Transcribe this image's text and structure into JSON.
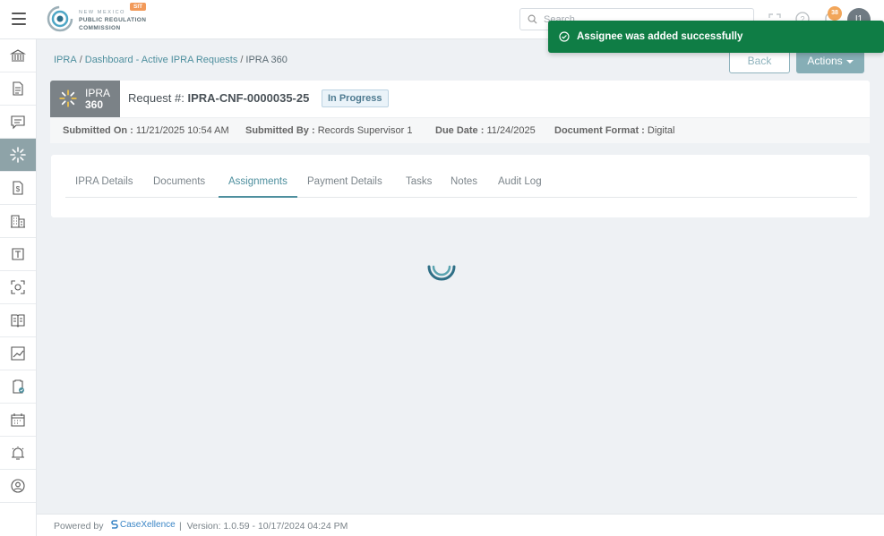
{
  "header": {
    "logo": {
      "line1": "NEW MEXICO",
      "line2": "PUBLIC REGULATION",
      "line3": "COMMISSION",
      "env_badge": "SIT"
    },
    "search": {
      "placeholder": "Search",
      "value": ""
    },
    "notification_count": "38",
    "avatar_initials": "I1"
  },
  "sidebar": {
    "items": [
      {
        "icon": "bank-icon"
      },
      {
        "icon": "document-icon"
      },
      {
        "icon": "chat-icon"
      },
      {
        "icon": "ipra-360-icon",
        "active": true
      },
      {
        "icon": "invoice-dollar-icon"
      },
      {
        "icon": "building-icon"
      },
      {
        "icon": "text-file-icon"
      },
      {
        "icon": "scan-icon"
      },
      {
        "icon": "book-icon"
      },
      {
        "icon": "chart-icon"
      },
      {
        "icon": "clipboard-check-icon"
      },
      {
        "icon": "calendar-icon"
      },
      {
        "icon": "alarm-icon"
      },
      {
        "icon": "user-circle-icon"
      }
    ]
  },
  "toast": {
    "message": "Assignee was added successfully",
    "color": "#0f7d45"
  },
  "breadcrumb": {
    "items": [
      "IPRA",
      "Dashboard - Active IPRA Requests"
    ],
    "current": "IPRA 360",
    "separator": "/"
  },
  "actions": {
    "back_label": "Back",
    "actions_label": "Actions"
  },
  "request": {
    "badge_line1": "IPRA",
    "badge_line2": "360",
    "title_prefix": "Request #:",
    "number": "IPRA-CNF-0000035-25",
    "status": "In Progress",
    "submitted_on_label": "Submitted On :",
    "submitted_on": "11/21/2025 10:54 AM",
    "submitted_by_label": "Submitted By :",
    "submitted_by": "Records Supervisor 1",
    "due_date_label": "Due Date :",
    "due_date": "11/24/2025",
    "format_label": "Document Format :",
    "format": "Digital"
  },
  "tabs": [
    {
      "label": "IPRA Details"
    },
    {
      "label": "Documents"
    },
    {
      "label": "Assignments",
      "active": true
    },
    {
      "label": "Payment Details"
    },
    {
      "label": "Tasks"
    },
    {
      "label": "Notes"
    },
    {
      "label": "Audit Log"
    }
  ],
  "footer": {
    "powered_by": "Powered by",
    "brand": "CaseXellence",
    "separator": "|",
    "version": "Version: 1.0.59 - 10/17/2024 04:24 PM"
  },
  "colors": {
    "accent": "#4e8f9e",
    "sidebar_active": "#8ea3a8",
    "status_bg": "#eaf3f9"
  }
}
